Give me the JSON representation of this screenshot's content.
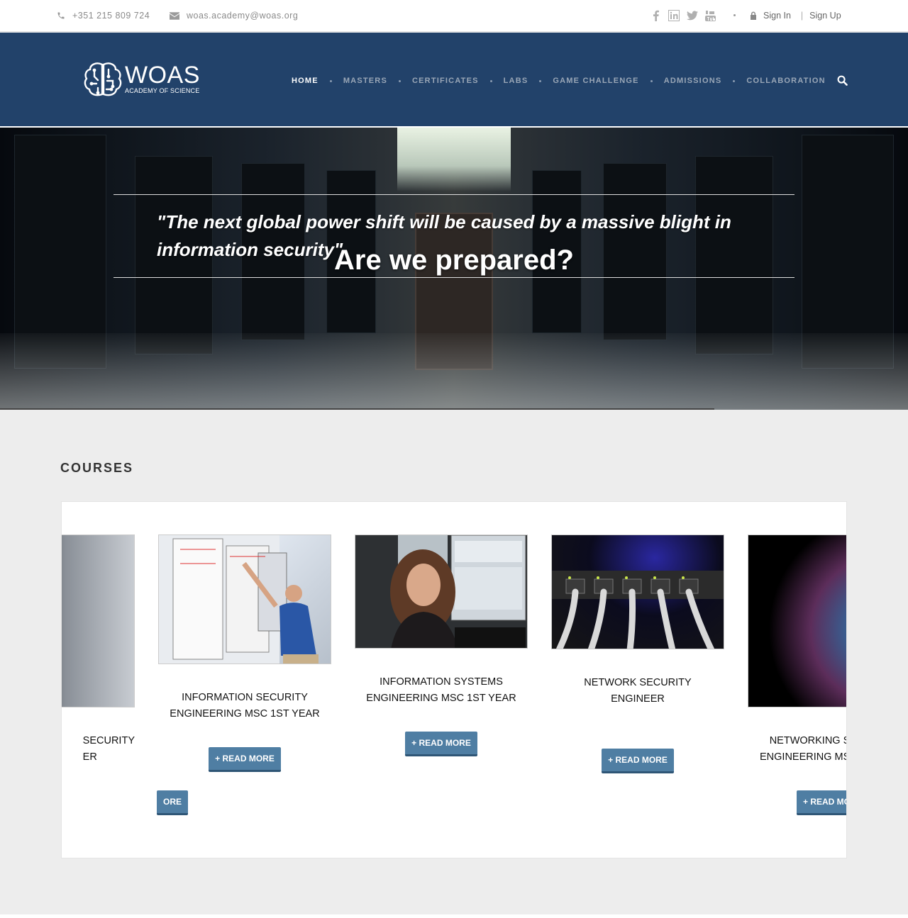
{
  "topbar": {
    "phone": "+351 215 809 724",
    "email": "woas.academy@woas.org",
    "social_icons": [
      "facebook-icon",
      "linkedin-icon",
      "twitter-icon",
      "youtube-icon"
    ],
    "sign_in": "Sign In",
    "separator": "|",
    "sign_up": "Sign Up"
  },
  "header": {
    "logo_name": "WOAS",
    "logo_sub": "ACADEMY OF SCIENCE",
    "nav": [
      {
        "label": "HOME",
        "active": true
      },
      {
        "label": "MASTERS",
        "active": false
      },
      {
        "label": "CERTIFICATES",
        "active": false
      },
      {
        "label": "LABS",
        "active": false
      },
      {
        "label": "GAME CHALLENGE",
        "active": false
      },
      {
        "label": "ADMISSIONS",
        "active": false
      },
      {
        "label": "COLLABORATION",
        "active": false
      }
    ],
    "bg_color": "#22426a"
  },
  "hero": {
    "quote": "\"The next global power shift will be caused by a massive blight in information security\"",
    "title": "Are we prepared?"
  },
  "courses": {
    "heading": "COURSES",
    "cards": [
      {
        "title_visible": "SECURITY\nER",
        "button": "ORE"
      },
      {
        "title": "INFORMATION SECURITY ENGINEERING MSC 1ST YEAR",
        "button": "+ READ MORE"
      },
      {
        "title": "INFORMATION SYSTEMS ENGINEERING MSC 1ST YEAR",
        "button": "+ READ MORE"
      },
      {
        "title": "NETWORK SECURITY ENGINEER",
        "button": "+ READ MORE"
      },
      {
        "title_visible": "NETWORKING S\nENGINEERING MS",
        "button": "+ READ MO"
      }
    ],
    "button_color": "#4f7ea3"
  }
}
